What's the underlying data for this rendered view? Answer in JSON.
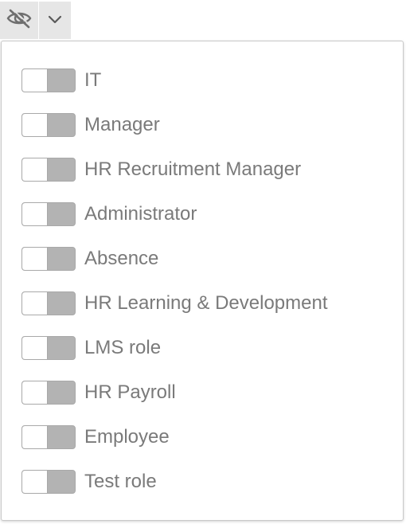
{
  "toolbar": {
    "visibility_icon": "eye-slash-icon",
    "dropdown_icon": "chevron-down-icon"
  },
  "roles": [
    {
      "label": "IT",
      "enabled": false
    },
    {
      "label": "Manager",
      "enabled": false
    },
    {
      "label": "HR Recruitment Manager",
      "enabled": false
    },
    {
      "label": "Administrator",
      "enabled": false
    },
    {
      "label": "Absence",
      "enabled": false
    },
    {
      "label": "HR Learning & Development",
      "enabled": false
    },
    {
      "label": "LMS role",
      "enabled": false
    },
    {
      "label": "HR Payroll",
      "enabled": false
    },
    {
      "label": "Employee",
      "enabled": false
    },
    {
      "label": "Test role",
      "enabled": false
    }
  ],
  "colors": {
    "toolbar_button_bg": "#e6e6e6",
    "toggle_off": "#b3b3b3",
    "label_text": "#7a7a7a"
  }
}
